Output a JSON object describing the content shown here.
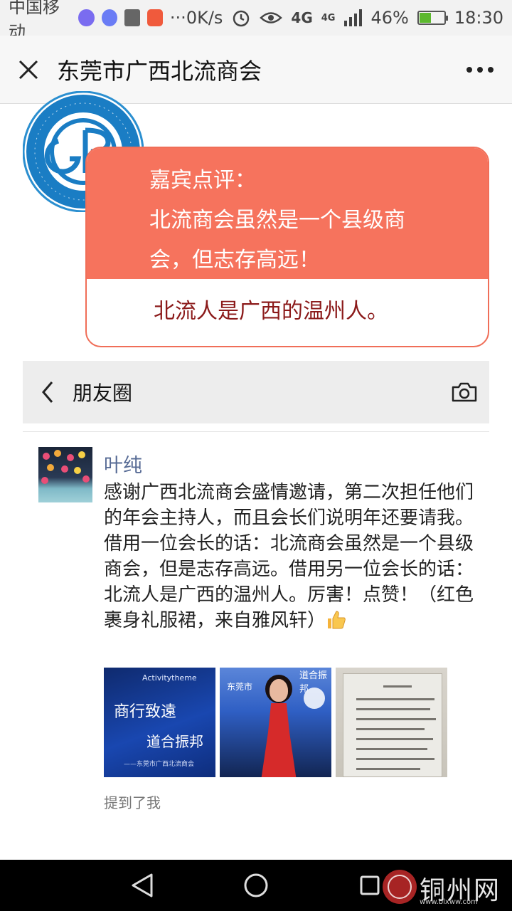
{
  "status_bar": {
    "carrier": "中国移动",
    "speed": "0K/s",
    "network": "4G",
    "network_small": "4G",
    "battery": "46%",
    "battery_level": 0.46,
    "time": "18:30"
  },
  "title_bar": {
    "title": "东莞市广西北流商会"
  },
  "quote": {
    "heading": "嘉宾点评：",
    "line1": "北流商会虽然是一个县级商",
    "line2": "会，但志存高远！",
    "bottom": "北流人是广西的温州人。"
  },
  "moments": {
    "title": "朋友圈"
  },
  "post": {
    "author": "叶纯",
    "text": "感谢广西北流商会盛情邀请，第二次担任他们的年会主持人，而且会长们说明年还要请我。借用一位会长的话：北流商会虽然是一个县级商会，但是志存高远。借用另一位会长的话：北流人是广西的温州人。厉害！点赞！（红色裹身礼服裙，来自雅风轩）",
    "mention": "提到了我"
  },
  "photos": {
    "p1_top": "Activitytheme",
    "p1_line1": "商行致遠",
    "p1_line2": "道合振邦",
    "p1_line3": "——东莞市广西北流商会",
    "p2_left": "东莞市",
    "p2_right": "道合振邦"
  },
  "watermark": {
    "text": "铜州网",
    "url": "www.blxww.com"
  },
  "colors": {
    "accent": "#f6735d",
    "link": "#576b95",
    "quote_bottom": "#8b1a1a"
  }
}
